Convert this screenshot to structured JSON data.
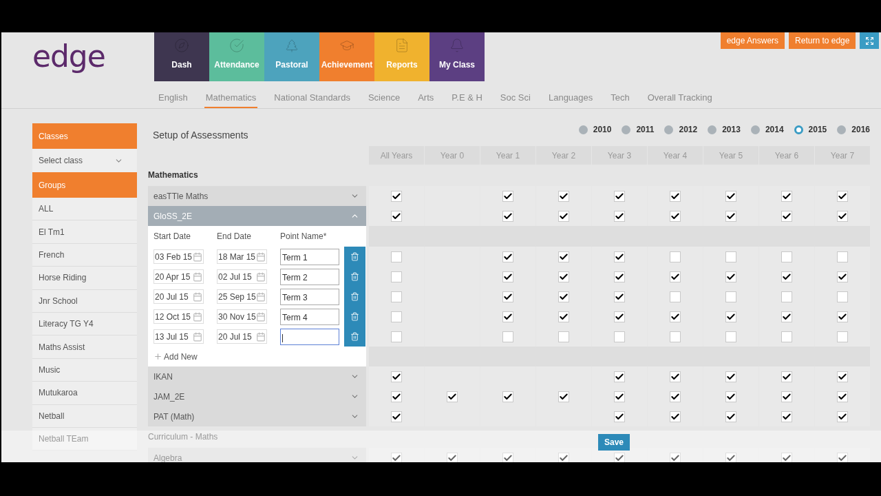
{
  "logo": "edge",
  "modules": [
    {
      "label": "Dash",
      "color": "#3e3650"
    },
    {
      "label": "Attendance",
      "color": "#5cbd9c"
    },
    {
      "label": "Pastoral",
      "color": "#4da3bd"
    },
    {
      "label": "Achievement",
      "color": "#f07f2e"
    },
    {
      "label": "Reports",
      "color": "#f0b22e"
    },
    {
      "label": "My Class",
      "color": "#5c3f82"
    }
  ],
  "top_buttons": [
    {
      "label": "edge Answers"
    },
    {
      "label": "Return to edge"
    }
  ],
  "subject_tabs": [
    {
      "label": "English",
      "selected": false
    },
    {
      "label": "Mathematics",
      "selected": true
    },
    {
      "label": "National Standards",
      "selected": false
    },
    {
      "label": "Science",
      "selected": false
    },
    {
      "label": "Arts",
      "selected": false
    },
    {
      "label": "P.E & H",
      "selected": false
    },
    {
      "label": "Soc Sci",
      "selected": false
    },
    {
      "label": "Languages",
      "selected": false
    },
    {
      "label": "Tech",
      "selected": false
    },
    {
      "label": "Overall Tracking",
      "selected": false
    }
  ],
  "sidebar": {
    "classes_heading": "Classes",
    "select_class": "Select class",
    "groups_heading": "Groups",
    "groups": [
      "ALL",
      "El Tm1",
      "French",
      "Horse Riding",
      "Jnr School",
      "Literacy TG Y4",
      "Maths Assist",
      "Music",
      "Mutukaroa",
      "Netball",
      "Netball TEam"
    ]
  },
  "page_title": "Setup of Assessments",
  "years": [
    {
      "label": "2010",
      "selected": false
    },
    {
      "label": "2011",
      "selected": false
    },
    {
      "label": "2012",
      "selected": false
    },
    {
      "label": "2013",
      "selected": false
    },
    {
      "label": "2014",
      "selected": false
    },
    {
      "label": "2015",
      "selected": true
    },
    {
      "label": "2016",
      "selected": false
    }
  ],
  "columns": [
    "All Years",
    "Year 0",
    "Year 1",
    "Year 2",
    "Year 3",
    "Year 4",
    "Year 5",
    "Year 6",
    "Year 7"
  ],
  "sections": [
    {
      "title": "Mathematics",
      "groups": [
        {
          "name": "easTTle Maths",
          "expanded": false,
          "cells": [
            {
              "kind": "checkbox",
              "checked": true
            },
            {
              "kind": "blank"
            },
            {
              "kind": "checkbox",
              "checked": true
            },
            {
              "kind": "checkbox",
              "checked": true
            },
            {
              "kind": "checkbox",
              "checked": true
            },
            {
              "kind": "checkbox",
              "checked": true
            },
            {
              "kind": "checkbox",
              "checked": true
            },
            {
              "kind": "checkbox",
              "checked": true
            },
            {
              "kind": "checkbox",
              "checked": true
            }
          ]
        },
        {
          "name": "GloSS_2E",
          "expanded": true,
          "cells": [
            {
              "kind": "checkbox",
              "checked": true
            },
            {
              "kind": "blank"
            },
            {
              "kind": "checkbox",
              "checked": true
            },
            {
              "kind": "checkbox",
              "checked": true
            },
            {
              "kind": "checkbox",
              "checked": true
            },
            {
              "kind": "checkbox",
              "checked": true
            },
            {
              "kind": "checkbox",
              "checked": true
            },
            {
              "kind": "checkbox",
              "checked": true
            },
            {
              "kind": "checkbox",
              "checked": true
            }
          ],
          "headers": {
            "start": "Start Date",
            "end": "End Date",
            "name": "Point Name*"
          },
          "points": [
            {
              "start": "03 Feb 15",
              "end": "18 Mar 15",
              "name": "Term 1",
              "focused": false,
              "cells": [
                {
                  "kind": "checkbox",
                  "checked": false
                },
                {
                  "kind": "blank"
                },
                {
                  "kind": "checkbox",
                  "checked": true
                },
                {
                  "kind": "checkbox",
                  "checked": true
                },
                {
                  "kind": "checkbox",
                  "checked": true
                },
                {
                  "kind": "checkbox",
                  "checked": false
                },
                {
                  "kind": "checkbox",
                  "checked": false
                },
                {
                  "kind": "checkbox",
                  "checked": false
                },
                {
                  "kind": "checkbox",
                  "checked": false
                }
              ]
            },
            {
              "start": "20 Apr 15",
              "end": "02 Jul 15",
              "name": "Term 2",
              "focused": false,
              "cells": [
                {
                  "kind": "checkbox",
                  "checked": false
                },
                {
                  "kind": "blank"
                },
                {
                  "kind": "checkbox",
                  "checked": true
                },
                {
                  "kind": "checkbox",
                  "checked": true
                },
                {
                  "kind": "checkbox",
                  "checked": true
                },
                {
                  "kind": "checkbox",
                  "checked": true
                },
                {
                  "kind": "checkbox",
                  "checked": true
                },
                {
                  "kind": "checkbox",
                  "checked": true
                },
                {
                  "kind": "checkbox",
                  "checked": true
                }
              ]
            },
            {
              "start": "20 Jul 15",
              "end": "25 Sep 15",
              "name": "Term 3",
              "focused": false,
              "cells": [
                {
                  "kind": "checkbox",
                  "checked": false
                },
                {
                  "kind": "blank"
                },
                {
                  "kind": "checkbox",
                  "checked": true
                },
                {
                  "kind": "checkbox",
                  "checked": true
                },
                {
                  "kind": "checkbox",
                  "checked": true
                },
                {
                  "kind": "checkbox",
                  "checked": false
                },
                {
                  "kind": "checkbox",
                  "checked": false
                },
                {
                  "kind": "checkbox",
                  "checked": false
                },
                {
                  "kind": "checkbox",
                  "checked": false
                }
              ]
            },
            {
              "start": "12 Oct 15",
              "end": "30 Nov 15",
              "name": "Term 4",
              "focused": false,
              "cells": [
                {
                  "kind": "checkbox",
                  "checked": false
                },
                {
                  "kind": "blank"
                },
                {
                  "kind": "checkbox",
                  "checked": true
                },
                {
                  "kind": "checkbox",
                  "checked": true
                },
                {
                  "kind": "checkbox",
                  "checked": true
                },
                {
                  "kind": "checkbox",
                  "checked": true
                },
                {
                  "kind": "checkbox",
                  "checked": true
                },
                {
                  "kind": "checkbox",
                  "checked": true
                },
                {
                  "kind": "checkbox",
                  "checked": true
                }
              ]
            },
            {
              "start": "13 Jul 15",
              "end": "20 Jul 15",
              "focused": true,
              "cells": [
                {
                  "kind": "checkbox",
                  "checked": false
                },
                {
                  "kind": "blank"
                },
                {
                  "kind": "checkbox",
                  "checked": false
                },
                {
                  "kind": "checkbox",
                  "checked": false
                },
                {
                  "kind": "checkbox",
                  "checked": false
                },
                {
                  "kind": "checkbox",
                  "checked": false
                },
                {
                  "kind": "checkbox",
                  "checked": false
                },
                {
                  "kind": "checkbox",
                  "checked": false
                },
                {
                  "kind": "checkbox",
                  "checked": false
                }
              ]
            }
          ],
          "add_new": "Add New"
        },
        {
          "name": "IKAN",
          "expanded": false,
          "cells": [
            {
              "kind": "checkbox",
              "checked": true
            },
            {
              "kind": "blank"
            },
            {
              "kind": "blank"
            },
            {
              "kind": "blank"
            },
            {
              "kind": "checkbox",
              "checked": true
            },
            {
              "kind": "checkbox",
              "checked": true
            },
            {
              "kind": "checkbox",
              "checked": true
            },
            {
              "kind": "checkbox",
              "checked": true
            },
            {
              "kind": "checkbox",
              "checked": true
            }
          ]
        },
        {
          "name": "JAM_2E",
          "expanded": false,
          "cells": [
            {
              "kind": "checkbox",
              "checked": true
            },
            {
              "kind": "checkbox",
              "checked": true
            },
            {
              "kind": "checkbox",
              "checked": true
            },
            {
              "kind": "checkbox",
              "checked": true
            },
            {
              "kind": "checkbox",
              "checked": true
            },
            {
              "kind": "checkbox",
              "checked": true
            },
            {
              "kind": "checkbox",
              "checked": true
            },
            {
              "kind": "checkbox",
              "checked": true
            },
            {
              "kind": "checkbox",
              "checked": true
            }
          ]
        },
        {
          "name": "PAT (Math)",
          "expanded": false,
          "cells": [
            {
              "kind": "checkbox",
              "checked": true
            },
            {
              "kind": "blank"
            },
            {
              "kind": "blank"
            },
            {
              "kind": "blank"
            },
            {
              "kind": "checkbox",
              "checked": true
            },
            {
              "kind": "checkbox",
              "checked": true
            },
            {
              "kind": "checkbox",
              "checked": true
            },
            {
              "kind": "checkbox",
              "checked": true
            },
            {
              "kind": "checkbox",
              "checked": true
            }
          ]
        }
      ]
    },
    {
      "title": "Curriculum - Maths",
      "groups": [
        {
          "name": "Algebra",
          "expanded": false,
          "cells": [
            {
              "kind": "checkbox",
              "checked": true
            },
            {
              "kind": "checkbox",
              "checked": true
            },
            {
              "kind": "checkbox",
              "checked": true
            },
            {
              "kind": "checkbox",
              "checked": true
            },
            {
              "kind": "checkbox",
              "checked": true
            },
            {
              "kind": "checkbox",
              "checked": true
            },
            {
              "kind": "checkbox",
              "checked": true
            },
            {
              "kind": "checkbox",
              "checked": true
            },
            {
              "kind": "checkbox",
              "checked": true
            }
          ]
        }
      ]
    }
  ],
  "save": "Save"
}
